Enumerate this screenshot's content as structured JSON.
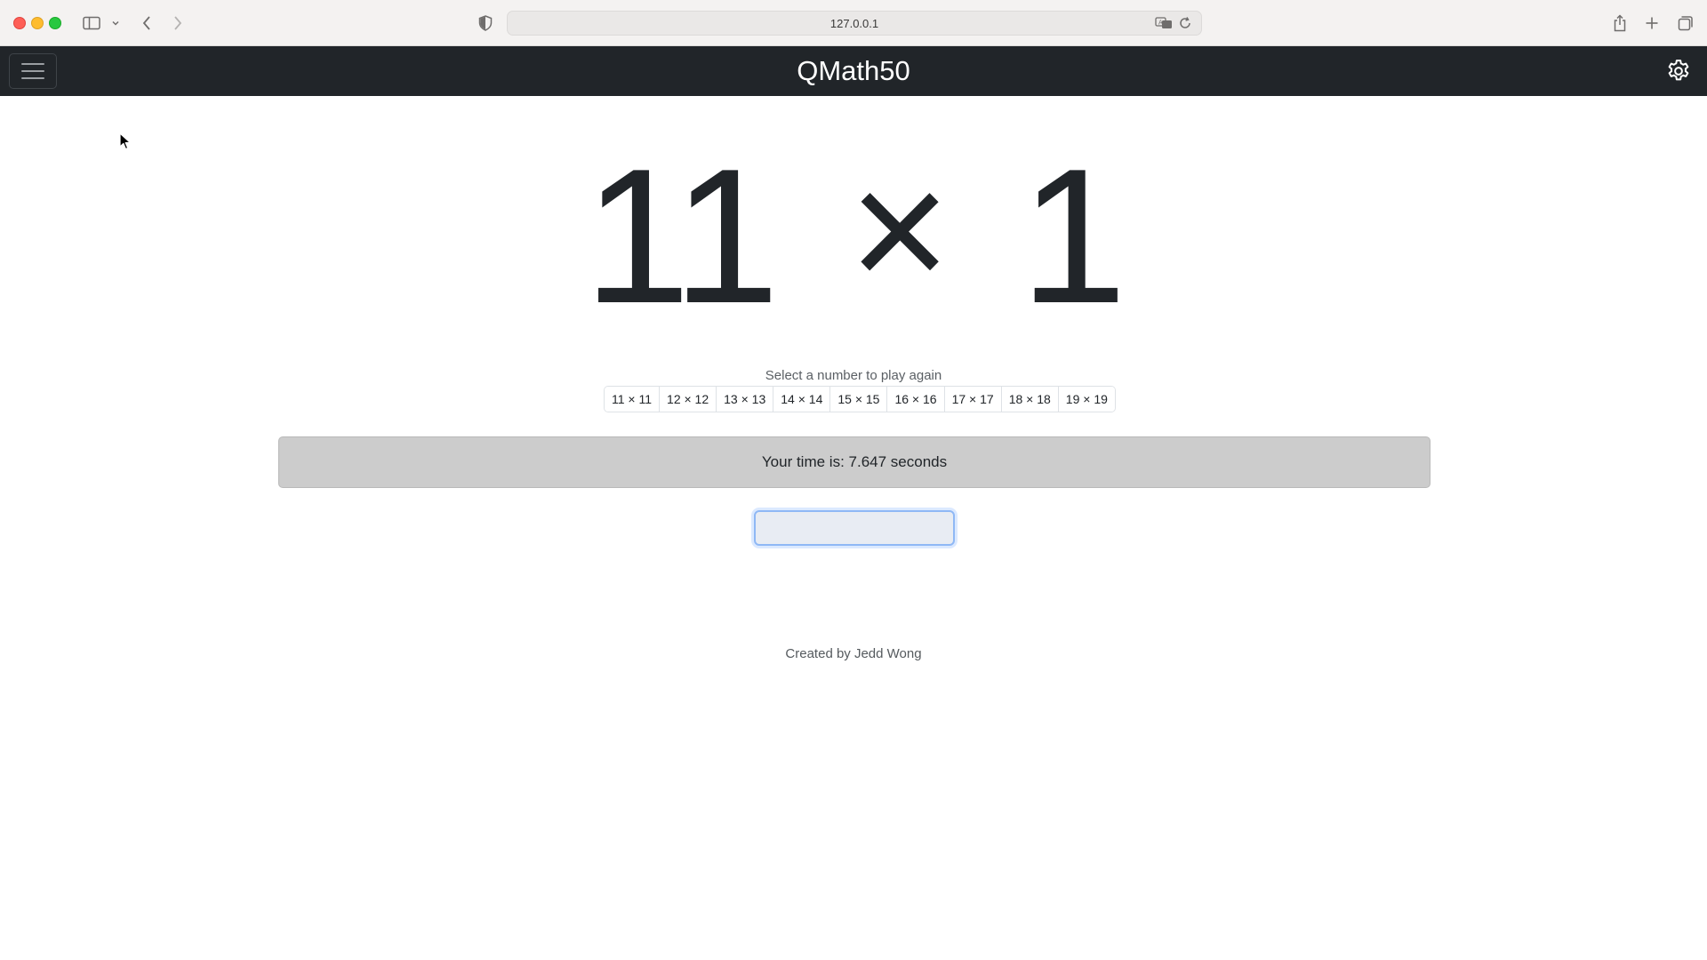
{
  "browser": {
    "url": "127.0.0.1"
  },
  "navbar": {
    "brand": "QMath50"
  },
  "problem": {
    "left": "11",
    "operator": "×",
    "right": "1"
  },
  "play_again": {
    "prompt": "Select a number to play again",
    "options": [
      "11 × 11",
      "12 × 12",
      "13 × 13",
      "14 × 14",
      "15 × 15",
      "16 × 16",
      "17 × 17",
      "18 × 18",
      "19 × 19"
    ]
  },
  "result": {
    "text": "Your time is: 7.647 seconds"
  },
  "answer": {
    "value": ""
  },
  "footer": {
    "credit": "Created by Jedd Wong"
  },
  "colors": {
    "navbar_bg": "#212529",
    "result_bg": "#cccccc",
    "input_focus": "#8fb8f5"
  },
  "icons": {
    "menu": "hamburger-icon",
    "settings": "gear-icon",
    "back": "chevron-left-icon",
    "forward": "chevron-right-icon",
    "sidebar": "sidebar-icon",
    "privacy": "shield-icon",
    "translate": "translate-icon",
    "reload": "reload-icon",
    "share": "share-icon",
    "new_tab": "plus-icon",
    "tabs": "tabs-overview-icon"
  }
}
